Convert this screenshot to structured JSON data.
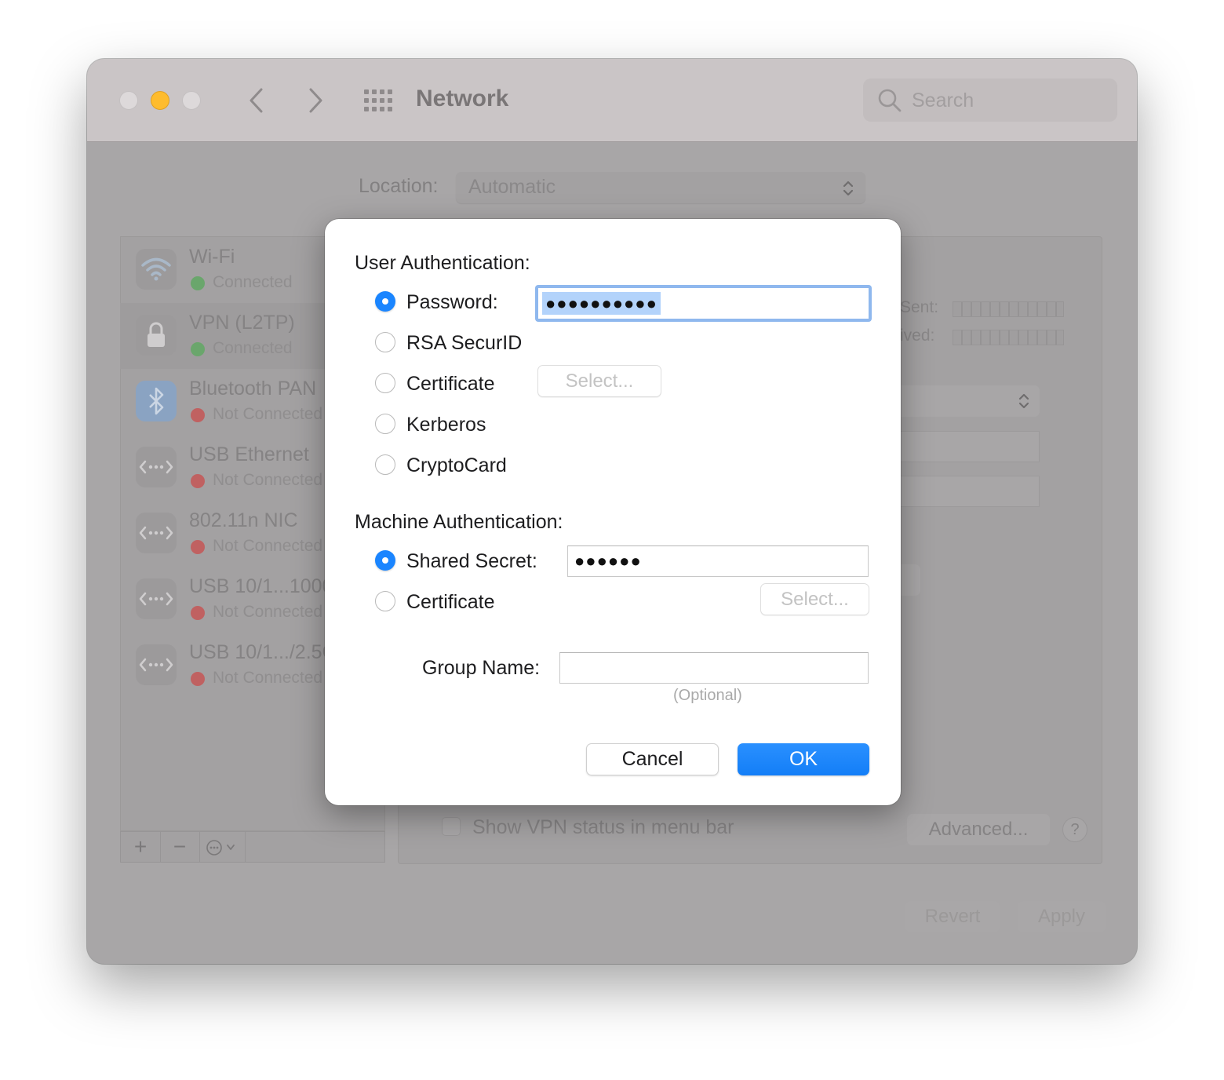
{
  "window": {
    "title": "Network",
    "search_placeholder": "Search"
  },
  "location": {
    "label": "Location:",
    "value": "Automatic"
  },
  "sidebar": {
    "items": [
      {
        "name": "Wi-Fi",
        "status": "Connected",
        "status_color": "#5aa85c",
        "icon": "wifi-icon"
      },
      {
        "name": "VPN (L2TP)",
        "status": "Connected",
        "status_color": "#5aa85c",
        "icon": "lock-icon"
      },
      {
        "name": "Bluetooth PAN",
        "status": "Not Connected",
        "status_color": "#c75a5a",
        "icon": "bluetooth-icon"
      },
      {
        "name": "USB Ethernet",
        "status": "Not Connected",
        "status_color": "#c75a5a",
        "icon": "ethernet-icon"
      },
      {
        "name": "802.11n NIC",
        "status": "Not Connected",
        "status_color": "#c75a5a",
        "icon": "ethernet-icon"
      },
      {
        "name": "USB 10/1...1000",
        "status": "Not Connected",
        "status_color": "#c75a5a",
        "icon": "ethernet-icon"
      },
      {
        "name": "USB 10/1.../2.5G",
        "status": "Not Connected",
        "status_color": "#c75a5a",
        "icon": "ethernet-icon"
      }
    ],
    "add": "+",
    "remove": "−",
    "action": "⋯"
  },
  "background_panel": {
    "sent_label": "Sent:",
    "received_label": "ived:",
    "show_vpn_status": "Show VPN status in menu bar",
    "advanced": "Advanced...",
    "help": "?",
    "revert": "Revert",
    "apply": "Apply"
  },
  "dialog": {
    "user_auth_title": "User Authentication:",
    "user_options": [
      {
        "label": "Password:",
        "selected": true
      },
      {
        "label": "RSA SecurID",
        "selected": false
      },
      {
        "label": "Certificate",
        "selected": false
      },
      {
        "label": "Kerberos",
        "selected": false
      },
      {
        "label": "CryptoCard",
        "selected": false
      }
    ],
    "password_value": "●●●●●●●●●●",
    "select_label": "Select...",
    "machine_auth_title": "Machine Authentication:",
    "machine_options": [
      {
        "label": "Shared Secret:",
        "selected": true
      },
      {
        "label": "Certificate",
        "selected": false
      }
    ],
    "shared_secret_value": "●●●●●●",
    "group_name_label": "Group Name:",
    "group_name_value": "",
    "optional_hint": "(Optional)",
    "cancel": "Cancel",
    "ok": "OK"
  },
  "colors": {
    "accent": "#1a85ff",
    "close_light": "#d9d5d6",
    "minimize_light": "#febc2e"
  }
}
